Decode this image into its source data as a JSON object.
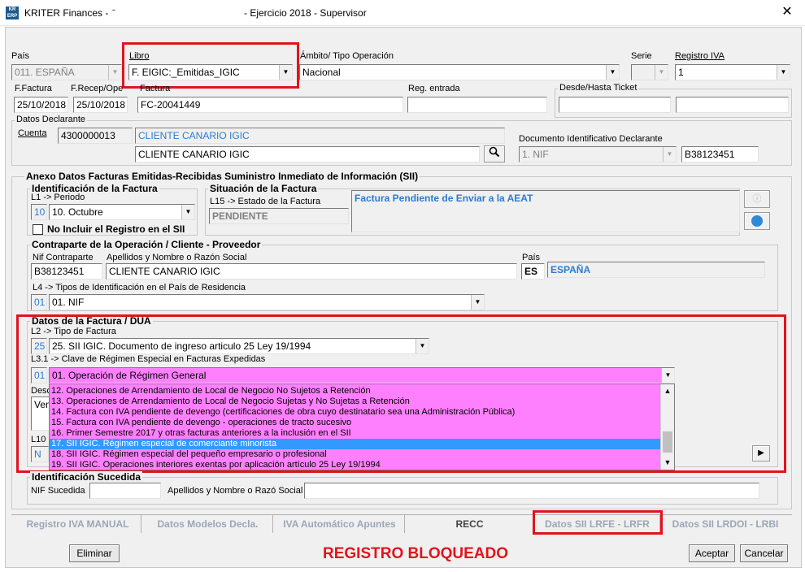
{
  "window": {
    "title_left": "KRITER Finances -  ̄",
    "title_mid": "- Ejercicio 2018 - Supervisor",
    "logo_text": "KR ERP",
    "close": "✕"
  },
  "header": {
    "pais_label": "País",
    "pais_value": "011. ESPAÑA",
    "libro_label": "Libro",
    "libro_value": "F. EIGIC:_Emitidas_IGIC",
    "ambito_label": "Ámbito/ Tipo Operación",
    "ambito_value": "Nacional",
    "serie_label": "Serie",
    "serie_value": "",
    "registro_iva_label": "Registro IVA",
    "registro_iva_value": "1",
    "ffactura_label": "F.Factura",
    "ffactura_value": "25/10/2018",
    "frecep_label": "F.Recep/Ope",
    "frecep_value": "25/10/2018",
    "factura_label": "Factura",
    "factura_value": "FC-20041449",
    "reg_entrada_label": "Reg. entrada",
    "reg_entrada_value": "",
    "ticket_label": "Desde/Hasta Ticket",
    "ticket_from": "",
    "ticket_to": ""
  },
  "declarante": {
    "group_title": "Datos Declarante",
    "cuenta_label": "Cuenta",
    "cuenta_value": "4300000013",
    "cliente_desc": "CLIENTE CANARIO IGIC",
    "cliente_name": "CLIENTE CANARIO IGIC",
    "doc_label": "Documento Identificativo Declarante",
    "doc_type": "1. NIF",
    "doc_value": "B38123451"
  },
  "sii": {
    "group_title": "Anexo Datos Facturas Emitidas-Recibidas Suministro Inmediato de Información (SII)",
    "identificacion_title": "Identificación de la Factura",
    "periodo_label": "L1 -> Periodo",
    "periodo_code": "10",
    "periodo_value": "10. Octubre",
    "no_incluir_label": "No Incluir el Registro en el SII",
    "situacion_title": "Situación de la Factura",
    "estado_label": "L15 -> Estado de la Factura",
    "estado_value": "PENDIENTE",
    "estado_desc": "Factura Pendiente de Enviar a la AEAT",
    "contraparte_title": "Contraparte de la Operación / Cliente - Proveedor",
    "nif_label": "Nif Contraparte",
    "nif_value": "B38123451",
    "nombre_label": "Apellidos y Nombre o Razón Social",
    "nombre_value": "CLIENTE CANARIO IGIC",
    "pais_label": "País",
    "pais_code": "ES",
    "pais_name": "ESPAÑA",
    "tipos_id_label": "L4 -> Tipos de Identificación en el País de Residencia",
    "tipos_id_code": "01",
    "tipos_id_value": "01. NIF",
    "datos_title": "Datos de la Factura / DUA",
    "tipo_factura_label": "L2 -> Tipo de Factura",
    "tipo_factura_code": "25",
    "tipo_factura_value": "25. SII IGIC. Documento de ingreso articulo 25 Ley 19/1994",
    "clave_label": "L3.1 -> Clave de Régimen Especial en Facturas Expedidas",
    "clave_code": "01",
    "clave_value": "01. Operación de Régimen General",
    "desc_label": "Desc",
    "desc_value": "Vent",
    "l10_label": "L10",
    "l10_value": "N",
    "dropdown_items": [
      "12. Operaciones de Arrendamiento de Local de Negocio No Sujetos a Retención",
      "13. Operaciones de Arrendamiento de Local de Negocio Sujetas y No Sujetas a Retención",
      "14. Factura con IVA pendiente de devengo (certificaciones de obra cuyo destinatario sea una Administración Pública)",
      "15. Factura con IVA pendiente de devengo - operaciones de tracto sucesivo",
      "16. Primer Semestre 2017 y otras facturas anteriores a la inclusión en el SII",
      "17. SII IGIC. Régimen especial de comerciante minorista",
      "18. SII IGIC. Régimen especial del pequeño empresario o profesional",
      "19. SII IGIC. Operaciones interiores exentas por aplicación artículo 25 Ley 19/1994"
    ],
    "sucedida_title": "Identificación Sucedida",
    "nif_sucedida_label": "NIF Sucedida",
    "nif_sucedida_value": "",
    "sucedida_nombre_label": "Apellidos y Nombre o Razó Social",
    "sucedida_nombre_value": ""
  },
  "tabs": [
    "Registro IVA MANUAL",
    "Datos Modelos Decla.",
    "IVA Automático Apuntes",
    "RECC",
    "Datos SII  LRFE - LRFR",
    "Datos SII LRDOI - LRBI"
  ],
  "footer": {
    "eliminar": "Eliminar",
    "blocked": "REGISTRO BLOQUEADO",
    "aceptar": "Aceptar",
    "cancelar": "Cancelar"
  },
  "colors": {
    "highlight_red": "#e0141e",
    "dropdown_bg": "#ff80ff",
    "selection_blue": "#3399ff",
    "link_blue": "#2b7bd1"
  }
}
